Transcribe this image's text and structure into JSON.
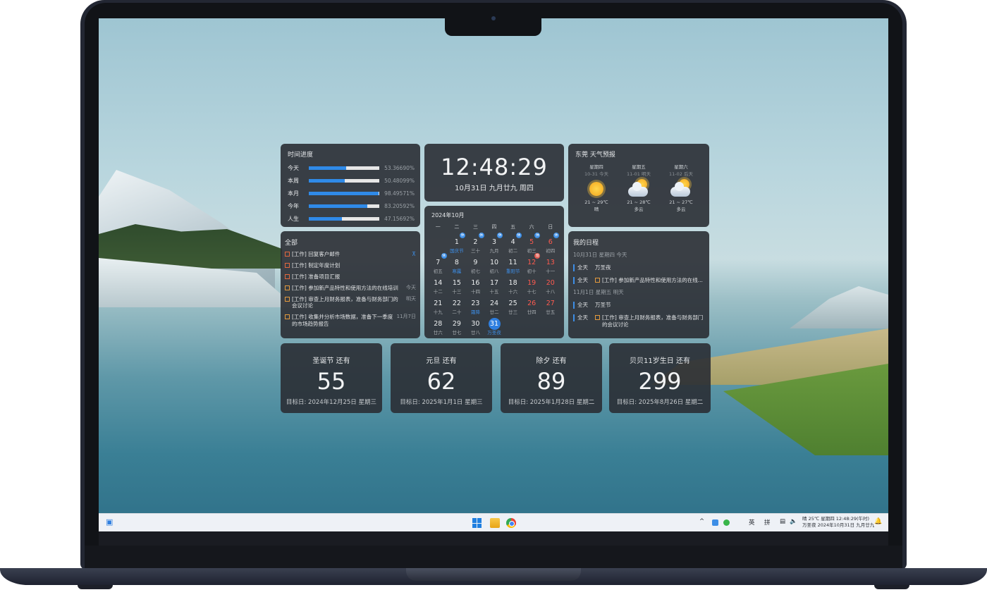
{
  "progress": {
    "title": "时间进度",
    "rows": [
      {
        "label": "今天",
        "value": "53.36690%",
        "fraction": 0.534
      },
      {
        "label": "本周",
        "value": "50.48099%",
        "fraction": 0.505
      },
      {
        "label": "本月",
        "value": "98.49571%",
        "fraction": 0.985
      },
      {
        "label": "今年",
        "value": "83.20592%",
        "fraction": 0.832
      },
      {
        "label": "人生",
        "value": "47.15692%",
        "fraction": 0.472
      }
    ]
  },
  "clock": {
    "time": "12:48:29",
    "date": "10月31日 九月廿九 周四"
  },
  "weather": {
    "title": "东莞 天气预报",
    "days": [
      {
        "day": "星期四",
        "date": "10-31 今天",
        "temp": "21 ~ 29℃",
        "cond": "晴",
        "icon": "sun-icon"
      },
      {
        "day": "星期五",
        "date": "11-01 明天",
        "temp": "21 ~ 28℃",
        "cond": "多云",
        "icon": "partly-cloudy-icon"
      },
      {
        "day": "星期六",
        "date": "11-02 后天",
        "temp": "21 ~ 27℃",
        "cond": "多云",
        "icon": "partly-cloudy-icon"
      }
    ]
  },
  "todo": {
    "title": "全部",
    "items": [
      {
        "text": "[工作] 回复客户邮件",
        "due": "",
        "pinned": true,
        "color": "#e3683e"
      },
      {
        "text": "[工作] 制定年度计划",
        "due": "",
        "pinned": false,
        "color": "#e3683e"
      },
      {
        "text": "[工作] 准备项目汇报",
        "due": "",
        "pinned": false,
        "color": "#e3683e"
      },
      {
        "text": "[工作] 参加新产品特性和使用方法的在线培训",
        "due": "今天",
        "pinned": false,
        "color": "#e39a3e"
      },
      {
        "text": "[工作] 审查上月财务报表，准备与财务部门的会议讨论",
        "due": "明天",
        "pinned": false,
        "color": "#e39a3e"
      },
      {
        "text": "[工作] 收集并分析市场数据，准备下一季度的市场趋势报告",
        "due": "11月7日",
        "pinned": false,
        "color": "#e39a3e"
      }
    ]
  },
  "calendar": {
    "title": "2024年10月",
    "weekdays": [
      "一",
      "二",
      "三",
      "四",
      "五",
      "六",
      "日"
    ],
    "weeks": [
      [
        {
          "n": "",
          "l": ""
        },
        {
          "n": "1",
          "l": "国庆节",
          "lb": true,
          "badge": "休"
        },
        {
          "n": "2",
          "l": "三十",
          "badge": "休"
        },
        {
          "n": "3",
          "l": "九月",
          "badge": "休"
        },
        {
          "n": "4",
          "l": "初二",
          "badge": "休"
        },
        {
          "n": "5",
          "l": "初三",
          "red": true,
          "badge": "休"
        },
        {
          "n": "6",
          "l": "初四",
          "red": true,
          "badge": "休"
        }
      ],
      [
        {
          "n": "7",
          "l": "初五",
          "badge": "休"
        },
        {
          "n": "8",
          "l": "寒露",
          "lb": true
        },
        {
          "n": "9",
          "l": "初七"
        },
        {
          "n": "10",
          "l": "初八"
        },
        {
          "n": "11",
          "l": "重阳节",
          "lb": true
        },
        {
          "n": "12",
          "l": "初十",
          "red": true,
          "badge": "班",
          "badgeRed": true
        },
        {
          "n": "13",
          "l": "十一",
          "red": true
        }
      ],
      [
        {
          "n": "14",
          "l": "十二"
        },
        {
          "n": "15",
          "l": "十三"
        },
        {
          "n": "16",
          "l": "十四"
        },
        {
          "n": "17",
          "l": "十五"
        },
        {
          "n": "18",
          "l": "十六"
        },
        {
          "n": "19",
          "l": "十七",
          "red": true
        },
        {
          "n": "20",
          "l": "十八",
          "red": true
        }
      ],
      [
        {
          "n": "21",
          "l": "十九"
        },
        {
          "n": "22",
          "l": "二十"
        },
        {
          "n": "23",
          "l": "霜降",
          "lb": true
        },
        {
          "n": "24",
          "l": "廿二"
        },
        {
          "n": "25",
          "l": "廿三"
        },
        {
          "n": "26",
          "l": "廿四",
          "red": true
        },
        {
          "n": "27",
          "l": "廿五",
          "red": true
        }
      ],
      [
        {
          "n": "28",
          "l": "廿六"
        },
        {
          "n": "29",
          "l": "廿七"
        },
        {
          "n": "30",
          "l": "廿八"
        },
        {
          "n": "31",
          "l": "万圣夜",
          "lb": true,
          "today": true
        },
        {
          "n": "",
          "l": ""
        },
        {
          "n": "",
          "l": ""
        },
        {
          "n": "",
          "l": ""
        }
      ]
    ]
  },
  "schedule": {
    "title": "我的日程",
    "groups": [
      {
        "date": "10月31日 星期四 今天",
        "items": [
          {
            "allday": "全天",
            "text": "万圣夜",
            "task": false
          },
          {
            "allday": "全天",
            "text": "[工作] 参加新产品特性和使用方法的在线...",
            "task": true
          }
        ]
      },
      {
        "date": "11月1日 星期五 明天",
        "items": [
          {
            "allday": "全天",
            "text": "万圣节",
            "task": false
          },
          {
            "allday": "全天",
            "text": "[工作] 审查上月财务报表，准备与财务部门的会议讨论",
            "task": true
          }
        ]
      }
    ]
  },
  "countdowns": [
    {
      "title": "圣诞节 还有",
      "days": "55",
      "target": "目标日: 2024年12月25日 星期三"
    },
    {
      "title": "元旦 还有",
      "days": "62",
      "target": "目标日: 2025年1月1日 星期三"
    },
    {
      "title": "除夕 还有",
      "days": "89",
      "target": "目标日: 2025年1月28日 星期二"
    },
    {
      "title": "贝贝11岁生日 还有",
      "days": "299",
      "target": "目标日: 2025年8月26日 星期二"
    }
  ],
  "taskbar": {
    "lang": "英",
    "ime": "拼",
    "tray_line1": "晴 25℃ 星期四 12:48:29(午时)",
    "tray_line2": "万圣夜 2024年10月31日 九月廿九",
    "caret": "^"
  }
}
